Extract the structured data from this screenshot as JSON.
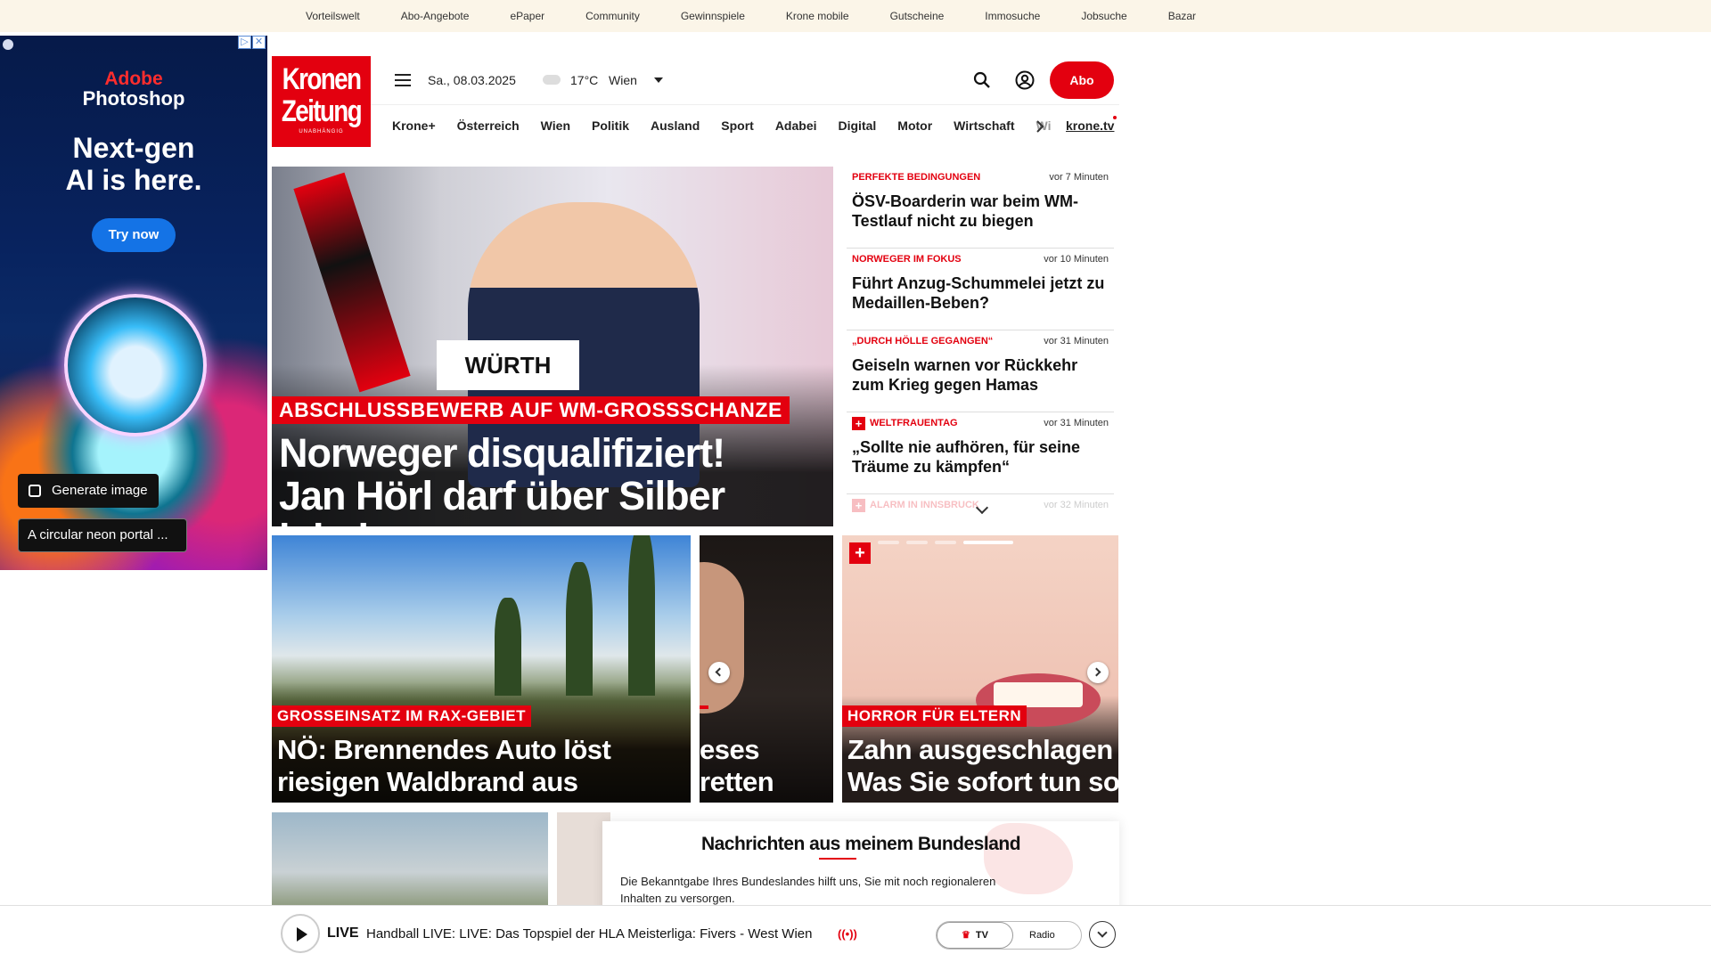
{
  "topbar": {
    "links": [
      "Vorteilswelt",
      "Abo-Angebote",
      "ePaper",
      "Community",
      "Gewinnspiele",
      "Krone mobile",
      "Gutscheine",
      "Immosuche",
      "Jobsuche",
      "Bazar"
    ]
  },
  "ad": {
    "brand_line1": "Adobe",
    "brand_line2": "Photoshop",
    "headline_line1": "Next-gen",
    "headline_line2": "AI is here.",
    "cta": "Try now",
    "generate_label": "Generate image",
    "prompt_text": "A circular neon portal ..."
  },
  "logo": {
    "line1": "Kronen",
    "line2": "Zeitung",
    "tagline": "UNABHÄNGIG"
  },
  "header": {
    "date": "Sa., 08.03.2025",
    "temperature": "17°C",
    "city": "Wien",
    "abo_label": "Abo"
  },
  "nav": {
    "items": [
      "Krone+",
      "Österreich",
      "Wien",
      "Politik",
      "Ausland",
      "Sport",
      "Adabei",
      "Digital",
      "Motor",
      "Wirtschaft",
      "Wiss"
    ],
    "kronetv": "krone.tv"
  },
  "hero": {
    "kicker": "ABSCHLUSSBEWERB AUF WM-GROSSSCHANZE",
    "title_line1": "Norweger disqualifiziert!",
    "title_line2": "Jan Hörl darf über Silber jubeln",
    "bib": "WÜRTH"
  },
  "sidebar_news": [
    {
      "category": "PERFEKTE BEDINGUNGEN",
      "time": "vor 7 Minuten",
      "headline": "ÖSV-Boarderin war beim WM-Testlauf nicht zu biegen",
      "plus": false
    },
    {
      "category": "NORWEGER IM FOKUS",
      "time": "vor 10 Minuten",
      "headline": "Führt Anzug-Schummelei jetzt zu Medaillen-Beben?",
      "plus": false
    },
    {
      "category": "„DURCH HÖLLE GEGANGEN“",
      "time": "vor 31 Minuten",
      "headline": "Geiseln warnen vor Rückkehr zum Krieg gegen Hamas",
      "plus": false
    },
    {
      "category": "WELTFRAUENTAG",
      "time": "vor 31 Minuten",
      "headline": "„Sollte nie aufhören, für seine Träume zu kämpfen“",
      "plus": true
    },
    {
      "category": "ALARM IN INNSBRUCK",
      "time": "vor 32 Minuten",
      "headline": "",
      "plus": true
    }
  ],
  "tiles": {
    "t1": {
      "kicker": "GROSSEINSATZ IM RAX-GEBIET",
      "title_line1": "NÖ: Brennendes Auto löst",
      "title_line2": "riesigen Waldbrand aus"
    },
    "t2": {
      "title_line1": "eses",
      "title_line2": "retten"
    },
    "t3": {
      "kicker": "HORROR FÜR ELTERN",
      "title_line1": "Zahn ausgeschlagen",
      "title_line2": "Was Sie sofort tun so"
    }
  },
  "bundesland": {
    "title": "Nachrichten aus meinem Bundesland",
    "text": "Die Bekanntgabe Ihres Bundeslandes hilft uns, Sie mit noch regionaleren Inhalten zu versorgen."
  },
  "live": {
    "label": "LIVE",
    "title": "Handball LIVE: LIVE: Das Topspiel der HLA Meisterliga: Fivers - West Wien",
    "broadcast_icon": "((•))",
    "tv_label": "TV",
    "radio_label": "Radio"
  },
  "colors": {
    "brand_red": "#e3000f",
    "topbar_bg": "#fbf5e8"
  }
}
